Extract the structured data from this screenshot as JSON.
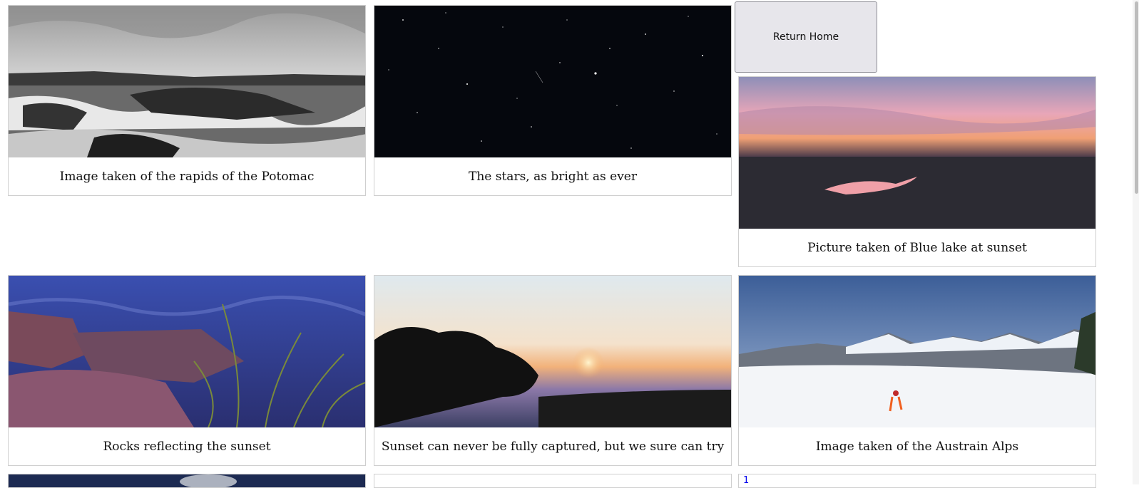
{
  "nav": {
    "return_home_label": "Return Home"
  },
  "gallery": {
    "items": [
      {
        "caption": "Image taken of the rapids of the Potomac",
        "image": "potomac-rapids-bw"
      },
      {
        "caption": "The stars, as bright as ever",
        "image": "night-sky-stars"
      },
      {
        "caption": "Picture taken of Blue lake at sunset",
        "image": "blue-lake-sunset"
      },
      {
        "caption": "Rocks reflecting the sunset",
        "image": "rocks-sunset-water"
      },
      {
        "caption": "Sunset can never be fully captured, but we sure can try",
        "image": "sunset-trees"
      },
      {
        "caption": "Image taken of the Austrain Alps",
        "image": "austrian-alps-skier"
      }
    ]
  },
  "partial_row": {
    "page_number": "1"
  }
}
